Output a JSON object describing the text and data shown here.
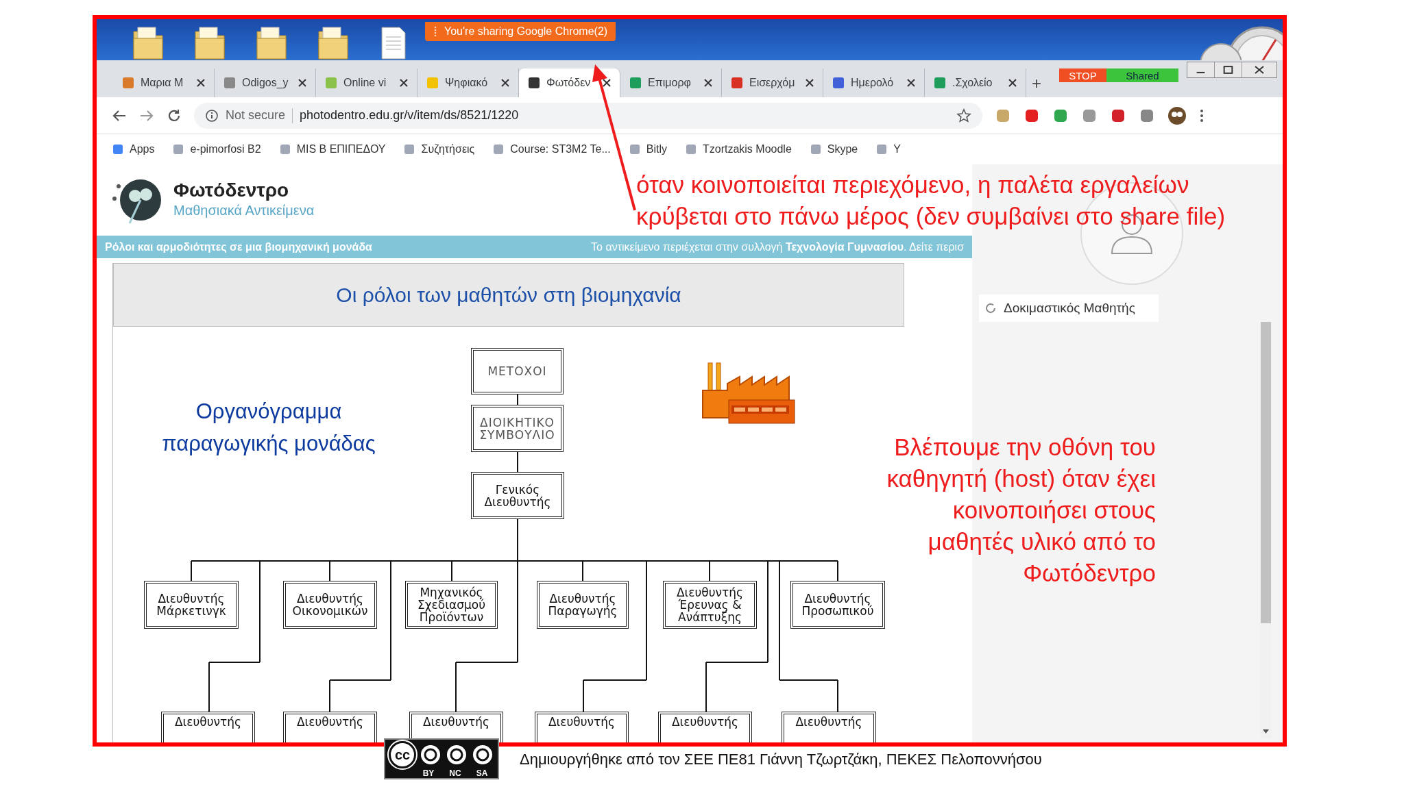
{
  "desktop": {
    "sharing_banner": "You're sharing Google Chrome(2)"
  },
  "browser": {
    "tabs": [
      {
        "label": "Μαρια Μ",
        "selected": false
      },
      {
        "label": "Odigos_y",
        "selected": false
      },
      {
        "label": "Online vi",
        "selected": false
      },
      {
        "label": "Ψηφιακό",
        "selected": false
      },
      {
        "label": "Φωτόδεν",
        "selected": true
      },
      {
        "label": "Επιμορφ",
        "selected": false
      },
      {
        "label": "Εισερχόμ",
        "selected": false
      },
      {
        "label": "Ημερολό",
        "selected": false
      },
      {
        "label": ".Σχολείο",
        "selected": false
      }
    ],
    "new_tab": "+",
    "share_controls": {
      "stop": "STOP",
      "shared": "Shared"
    },
    "address": {
      "security": "Not secure",
      "url": "photodentro.edu.gr/v/item/ds/8521/1220"
    },
    "bookmarks": [
      "Apps",
      "e-pimorfosi B2",
      "MIS B ΕΠΙΠΕΔΟΥ",
      "Συζητήσεις",
      "Course: ST3M2 Te...",
      "Bitly",
      "Tzortzakis Moodle",
      "Skype",
      "Y"
    ]
  },
  "page": {
    "site_title": "Φωτόδεντρο",
    "site_subtitle": "Μαθησιακά Αντικείμενα",
    "item_title": "Ρόλοι και αρμοδιότητες σε μια βιομηχανική μονάδα",
    "collection_note": "Το αντικείμενο περιέχεται στην συλλογή **Τεχνολογία Γυμνασίου**. Δείτε περισ",
    "slide": {
      "title": "Οι ρόλοι των μαθητών στη βιομηχανία",
      "chart_heading": [
        "Οργανόγραμμα",
        "παραγωγικής μονάδας"
      ],
      "nodes": [
        {
          "lines": [
            "ΜΕΤΟΧΟΙ"
          ]
        },
        {
          "lines": [
            "ΔΙΟΙΚΗΤΙΚΟ",
            "ΣΥΜΒΟΥΛΙΟ"
          ]
        },
        {
          "lines": [
            "Γενικός",
            "Διευθυντής"
          ]
        },
        {
          "lines": [
            "Διευθυντής",
            "Μάρκετινγκ"
          ]
        },
        {
          "lines": [
            "Διευθυντής",
            "Οικονομικών"
          ]
        },
        {
          "lines": [
            "Μηχανικός",
            "Σχεδιασμού",
            "Προϊόντων"
          ]
        },
        {
          "lines": [
            "Διευθυντής",
            "Παραγωγής"
          ]
        },
        {
          "lines": [
            "Διευθυντής",
            "Έρευνας &",
            "Ανάπτυξης"
          ]
        },
        {
          "lines": [
            "Διευθυντής",
            "Προσωπικού"
          ]
        },
        {
          "lines": [
            "Διευθυντής"
          ]
        },
        {
          "lines": [
            "Διευθυντής"
          ]
        },
        {
          "lines": [
            "Διευθυντής"
          ]
        },
        {
          "lines": [
            "Διευθυντής"
          ]
        },
        {
          "lines": [
            "Διευθυντής"
          ]
        },
        {
          "lines": [
            "Διευθυντής"
          ]
        }
      ]
    }
  },
  "participants_panel": {
    "name": "Δοκιμαστικός Μαθητής"
  },
  "annotations": {
    "top_note": [
      "όταν κοινοποιείται περιεχόμενο, η παλέτα εργαλείων",
      "κρύβεται στο πάνω μέρος (δεν συμβαίνει στο share file)"
    ],
    "side_note": [
      "Βλέπουμε την οθόνη του",
      "καθηγητή (host) όταν έχει",
      "κοινοποιήσει στους",
      "μαθητές υλικό από το",
      "Φωτόδεντρο"
    ]
  },
  "footer": {
    "license_mark": "cc",
    "license_labels": [
      "BY",
      "NC",
      "SA"
    ],
    "credit": "Δημιουργήθηκε από τον ΣΕΕ ΠΕ81 Γιάννη Τζωρτζάκη, ΠΕΚΕΣ Πελοποννήσου"
  }
}
